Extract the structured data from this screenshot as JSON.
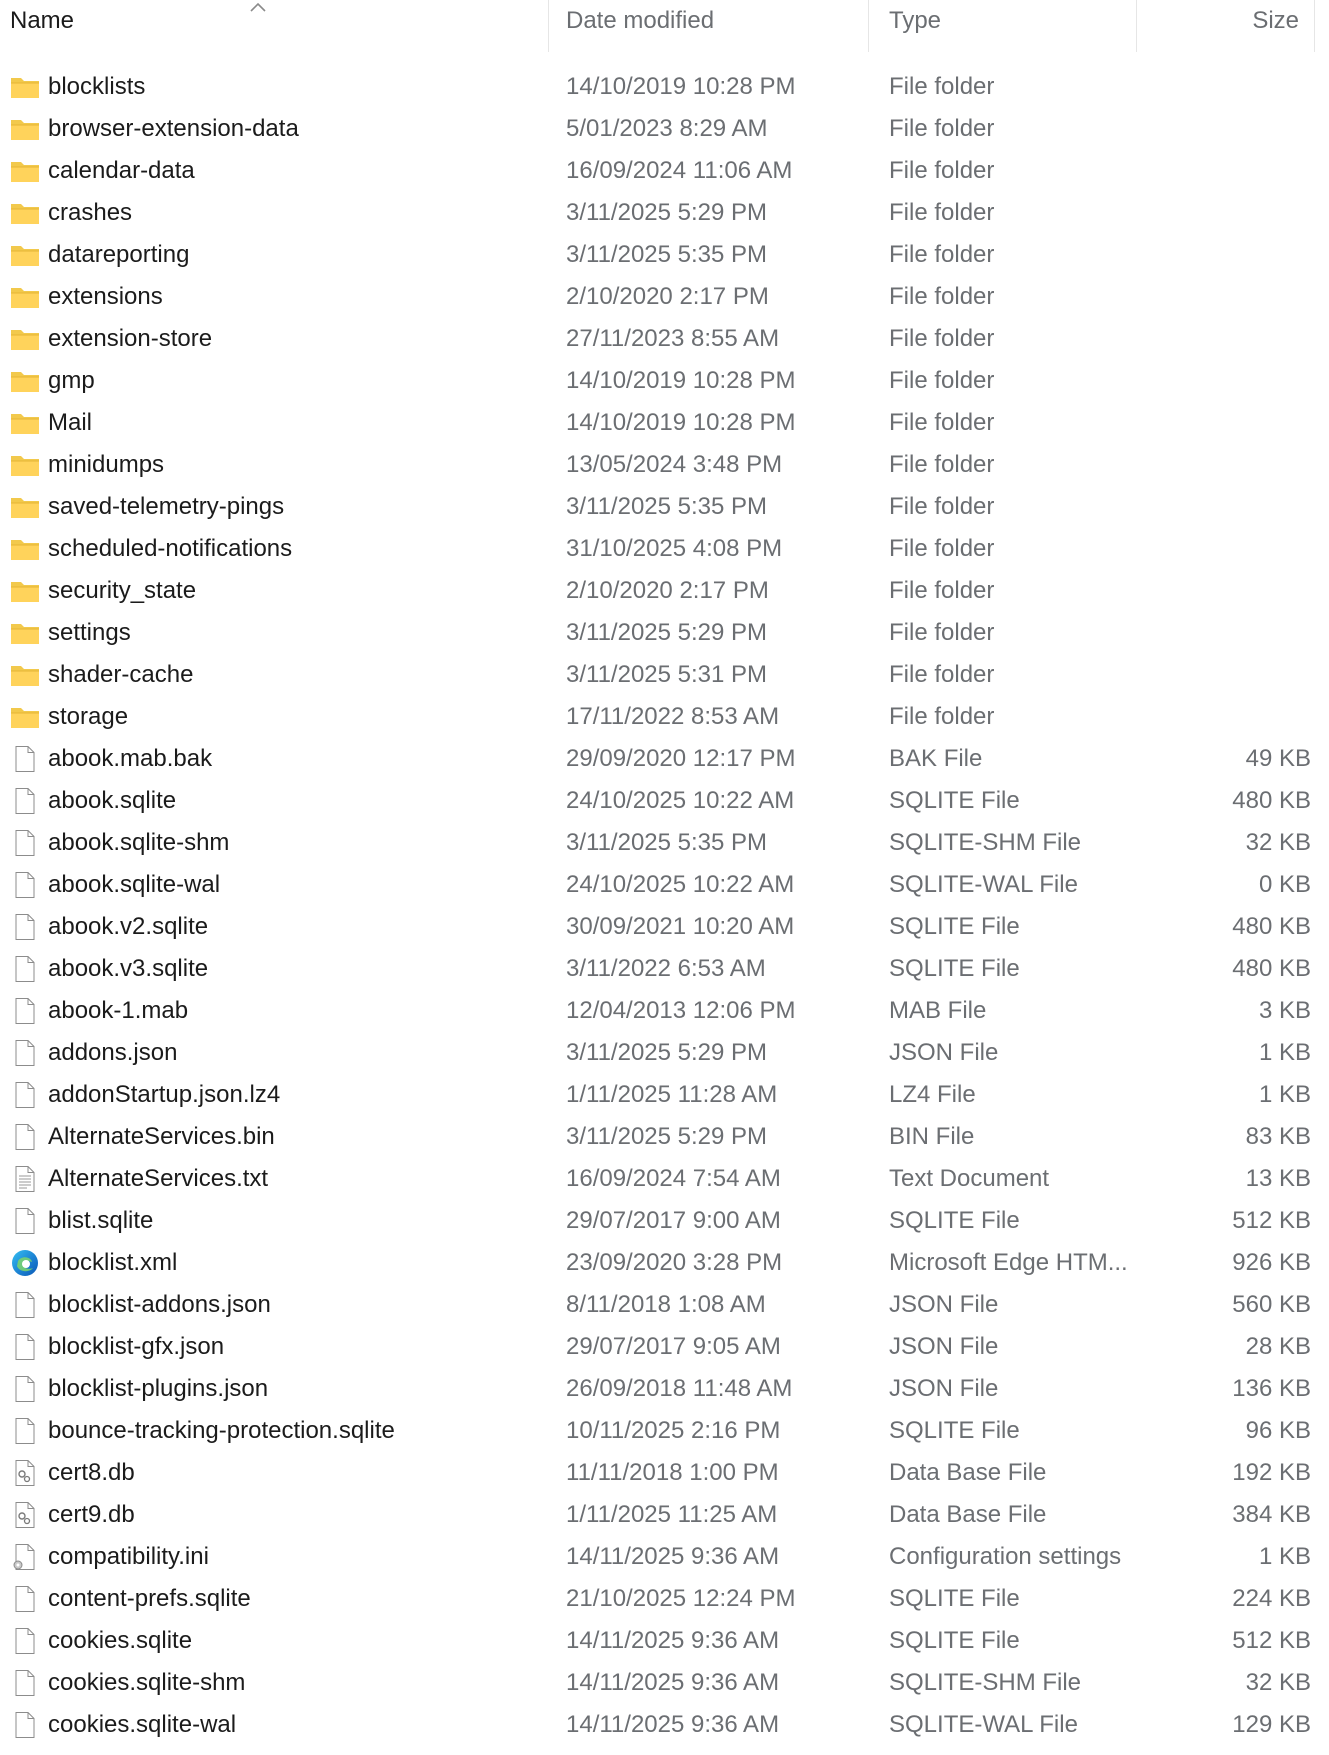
{
  "columns": {
    "name": "Name",
    "date": "Date modified",
    "type": "Type",
    "size": "Size"
  },
  "rows": [
    {
      "name": "blocklists",
      "date": "14/10/2019 10:28 PM",
      "type": "File folder",
      "size": "",
      "icon": "folder"
    },
    {
      "name": "browser-extension-data",
      "date": "5/01/2023 8:29 AM",
      "type": "File folder",
      "size": "",
      "icon": "folder"
    },
    {
      "name": "calendar-data",
      "date": "16/09/2024 11:06 AM",
      "type": "File folder",
      "size": "",
      "icon": "folder"
    },
    {
      "name": "crashes",
      "date": "3/11/2025 5:29 PM",
      "type": "File folder",
      "size": "",
      "icon": "folder"
    },
    {
      "name": "datareporting",
      "date": "3/11/2025 5:35 PM",
      "type": "File folder",
      "size": "",
      "icon": "folder"
    },
    {
      "name": "extensions",
      "date": "2/10/2020 2:17 PM",
      "type": "File folder",
      "size": "",
      "icon": "folder"
    },
    {
      "name": "extension-store",
      "date": "27/11/2023 8:55 AM",
      "type": "File folder",
      "size": "",
      "icon": "folder"
    },
    {
      "name": "gmp",
      "date": "14/10/2019 10:28 PM",
      "type": "File folder",
      "size": "",
      "icon": "folder"
    },
    {
      "name": "Mail",
      "date": "14/10/2019 10:28 PM",
      "type": "File folder",
      "size": "",
      "icon": "folder"
    },
    {
      "name": "minidumps",
      "date": "13/05/2024 3:48 PM",
      "type": "File folder",
      "size": "",
      "icon": "folder"
    },
    {
      "name": "saved-telemetry-pings",
      "date": "3/11/2025 5:35 PM",
      "type": "File folder",
      "size": "",
      "icon": "folder"
    },
    {
      "name": "scheduled-notifications",
      "date": "31/10/2025 4:08 PM",
      "type": "File folder",
      "size": "",
      "icon": "folder"
    },
    {
      "name": "security_state",
      "date": "2/10/2020 2:17 PM",
      "type": "File folder",
      "size": "",
      "icon": "folder"
    },
    {
      "name": "settings",
      "date": "3/11/2025 5:29 PM",
      "type": "File folder",
      "size": "",
      "icon": "folder"
    },
    {
      "name": "shader-cache",
      "date": "3/11/2025 5:31 PM",
      "type": "File folder",
      "size": "",
      "icon": "folder"
    },
    {
      "name": "storage",
      "date": "17/11/2022 8:53 AM",
      "type": "File folder",
      "size": "",
      "icon": "folder"
    },
    {
      "name": "abook.mab.bak",
      "date": "29/09/2020 12:17 PM",
      "type": "BAK File",
      "size": "49 KB",
      "icon": "file"
    },
    {
      "name": "abook.sqlite",
      "date": "24/10/2025 10:22 AM",
      "type": "SQLITE File",
      "size": "480 KB",
      "icon": "file"
    },
    {
      "name": "abook.sqlite-shm",
      "date": "3/11/2025 5:35 PM",
      "type": "SQLITE-SHM File",
      "size": "32 KB",
      "icon": "file"
    },
    {
      "name": "abook.sqlite-wal",
      "date": "24/10/2025 10:22 AM",
      "type": "SQLITE-WAL File",
      "size": "0 KB",
      "icon": "file"
    },
    {
      "name": "abook.v2.sqlite",
      "date": "30/09/2021 10:20 AM",
      "type": "SQLITE File",
      "size": "480 KB",
      "icon": "file"
    },
    {
      "name": "abook.v3.sqlite",
      "date": "3/11/2022 6:53 AM",
      "type": "SQLITE File",
      "size": "480 KB",
      "icon": "file"
    },
    {
      "name": "abook-1.mab",
      "date": "12/04/2013 12:06 PM",
      "type": "MAB File",
      "size": "3 KB",
      "icon": "file"
    },
    {
      "name": "addons.json",
      "date": "3/11/2025 5:29 PM",
      "type": "JSON File",
      "size": "1 KB",
      "icon": "file"
    },
    {
      "name": "addonStartup.json.lz4",
      "date": "1/11/2025 11:28 AM",
      "type": "LZ4 File",
      "size": "1 KB",
      "icon": "file"
    },
    {
      "name": "AlternateServices.bin",
      "date": "3/11/2025 5:29 PM",
      "type": "BIN File",
      "size": "83 KB",
      "icon": "file"
    },
    {
      "name": "AlternateServices.txt",
      "date": "16/09/2024 7:54 AM",
      "type": "Text Document",
      "size": "13 KB",
      "icon": "text"
    },
    {
      "name": "blist.sqlite",
      "date": "29/07/2017 9:00 AM",
      "type": "SQLITE File",
      "size": "512 KB",
      "icon": "file"
    },
    {
      "name": "blocklist.xml",
      "date": "23/09/2020 3:28 PM",
      "type": "Microsoft Edge HTM...",
      "size": "926 KB",
      "icon": "edge"
    },
    {
      "name": "blocklist-addons.json",
      "date": "8/11/2018 1:08 AM",
      "type": "JSON File",
      "size": "560 KB",
      "icon": "file"
    },
    {
      "name": "blocklist-gfx.json",
      "date": "29/07/2017 9:05 AM",
      "type": "JSON File",
      "size": "28 KB",
      "icon": "file"
    },
    {
      "name": "blocklist-plugins.json",
      "date": "26/09/2018 11:48 AM",
      "type": "JSON File",
      "size": "136 KB",
      "icon": "file"
    },
    {
      "name": "bounce-tracking-protection.sqlite",
      "date": "10/11/2025 2:16 PM",
      "type": "SQLITE File",
      "size": "96 KB",
      "icon": "file"
    },
    {
      "name": "cert8.db",
      "date": "11/11/2018 1:00 PM",
      "type": "Data Base File",
      "size": "192 KB",
      "icon": "dbfile"
    },
    {
      "name": "cert9.db",
      "date": "1/11/2025 11:25 AM",
      "type": "Data Base File",
      "size": "384 KB",
      "icon": "dbfile"
    },
    {
      "name": "compatibility.ini",
      "date": "14/11/2025 9:36 AM",
      "type": "Configuration settings",
      "size": "1 KB",
      "icon": "inifile"
    },
    {
      "name": "content-prefs.sqlite",
      "date": "21/10/2025 12:24 PM",
      "type": "SQLITE File",
      "size": "224 KB",
      "icon": "file"
    },
    {
      "name": "cookies.sqlite",
      "date": "14/11/2025 9:36 AM",
      "type": "SQLITE File",
      "size": "512 KB",
      "icon": "file"
    },
    {
      "name": "cookies.sqlite-shm",
      "date": "14/11/2025 9:36 AM",
      "type": "SQLITE-SHM File",
      "size": "32 KB",
      "icon": "file"
    },
    {
      "name": "cookies.sqlite-wal",
      "date": "14/11/2025 9:36 AM",
      "type": "SQLITE-WAL File",
      "size": "129 KB",
      "icon": "file"
    }
  ]
}
